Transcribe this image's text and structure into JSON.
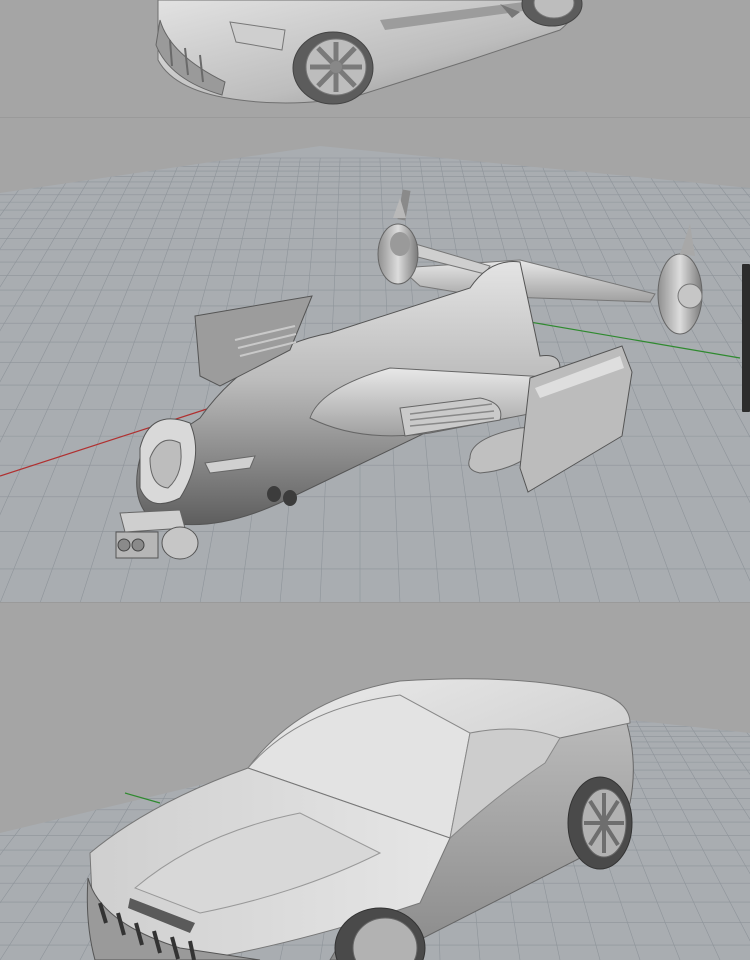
{
  "viewports": [
    {
      "id": "top",
      "model": "sports-car-rear-three-quarter",
      "label": ""
    },
    {
      "id": "middle",
      "model": "tilt-rotor-aircraft",
      "label": ""
    },
    {
      "id": "bottom",
      "model": "muscle-car-front-three-quarter",
      "label": ""
    }
  ],
  "colors": {
    "background": "#a5a5a5",
    "grid_line": "#8e949a",
    "grid_major": "#7f858c",
    "axis_x": "#b03030",
    "axis_y": "#2f8a2f",
    "model_light": "#d8d8d8",
    "model_mid": "#b4b4b4",
    "model_dark": "#6e6e6e",
    "scroll_handle": "#2c2c2c"
  }
}
